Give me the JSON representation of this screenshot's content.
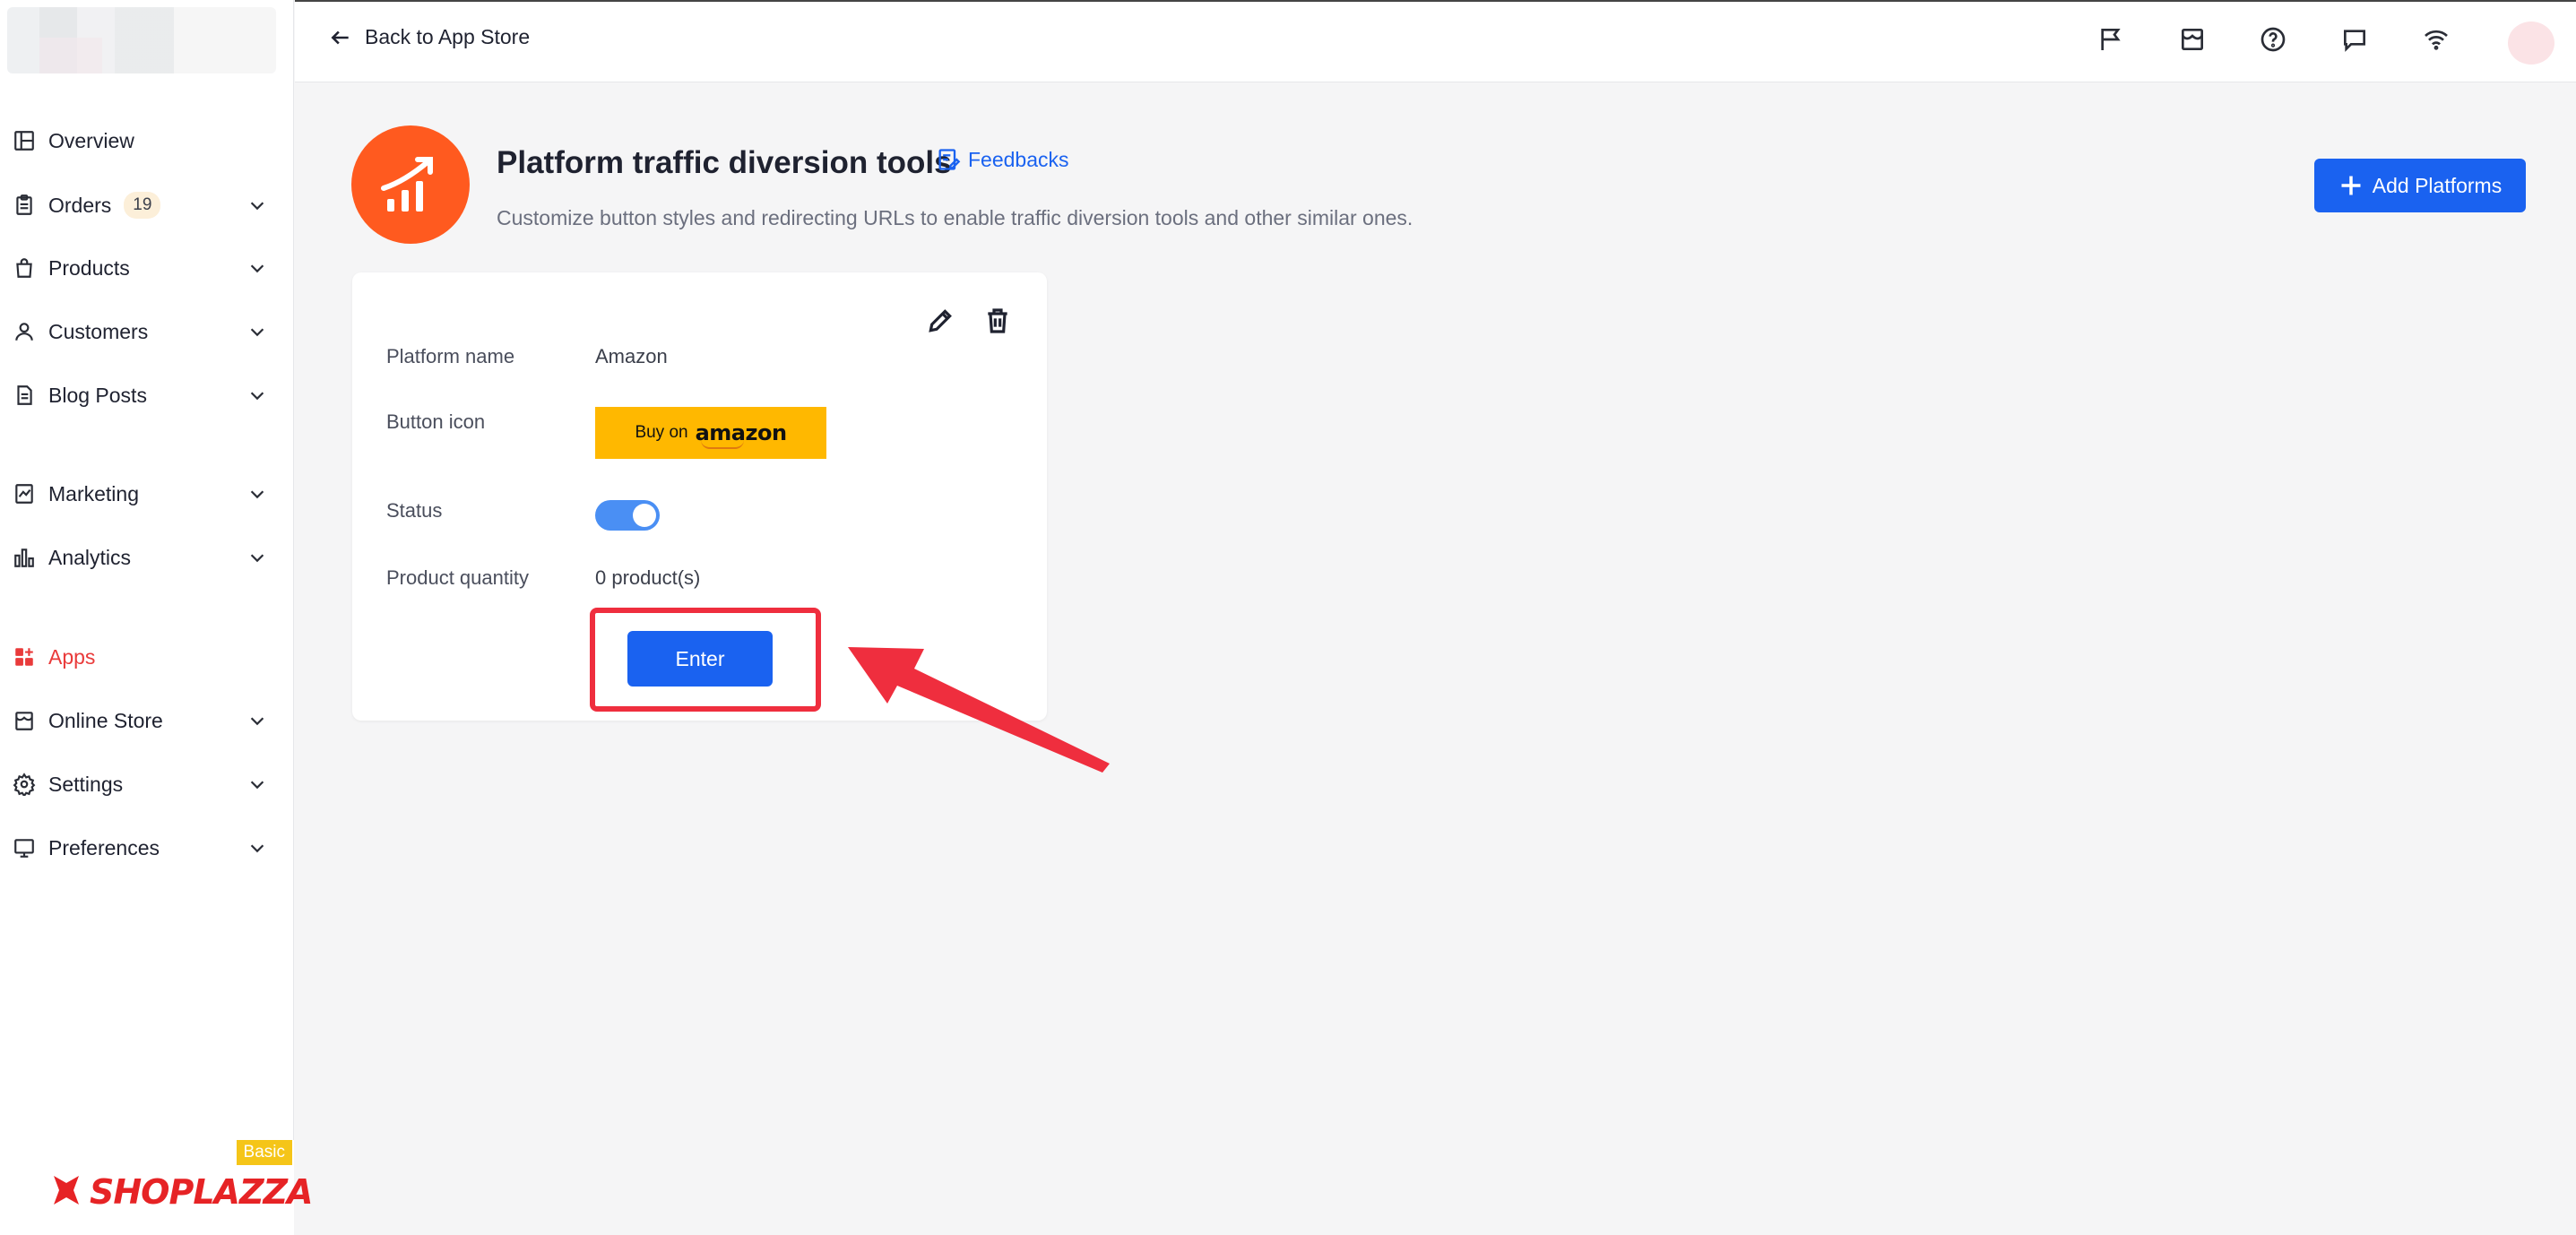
{
  "sidebar": {
    "items": [
      {
        "label": "Overview",
        "icon": "layout-icon"
      },
      {
        "label": "Orders",
        "icon": "clipboard-icon",
        "badge": "19"
      },
      {
        "label": "Products",
        "icon": "shopping-bag-icon"
      },
      {
        "label": "Customers",
        "icon": "user-icon"
      },
      {
        "label": "Blog Posts",
        "icon": "document-icon"
      },
      {
        "label": "Marketing",
        "icon": "marketing-icon"
      },
      {
        "label": "Analytics",
        "icon": "bar-chart-icon"
      },
      {
        "label": "Apps",
        "icon": "apps-grid-icon",
        "active": true
      },
      {
        "label": "Online Store",
        "icon": "storefront-icon"
      },
      {
        "label": "Settings",
        "icon": "gear-icon"
      },
      {
        "label": "Preferences",
        "icon": "monitor-icon"
      }
    ],
    "brand": {
      "name": "SHOPLAZZA",
      "plan": "Basic"
    }
  },
  "topbar": {
    "back_label": "Back to App Store",
    "icons": [
      "flag-icon",
      "store-icon",
      "help-icon",
      "chat-icon",
      "wifi-icon",
      "avatar"
    ]
  },
  "app": {
    "title": "Platform traffic diversion tools",
    "feedbacks_label": "Feedbacks",
    "description": "Customize button styles and redirecting URLs to enable traffic diversion tools and other similar ones.",
    "add_button_label": "Add Platforms",
    "accent_color": "#1a62f0",
    "logo_color": "#ff5a1f"
  },
  "platform_card": {
    "rows": {
      "platform_name": {
        "label": "Platform name",
        "value": "Amazon"
      },
      "button_icon": {
        "label": "Button icon",
        "buy_text": "Buy on",
        "logo_text": "amazon"
      },
      "status": {
        "label": "Status",
        "enabled": true
      },
      "product_quantity": {
        "label": "Product quantity",
        "value": "0 product(s)"
      }
    },
    "enter_label": "Enter"
  },
  "annotation": {
    "color": "#ef2e3e"
  }
}
